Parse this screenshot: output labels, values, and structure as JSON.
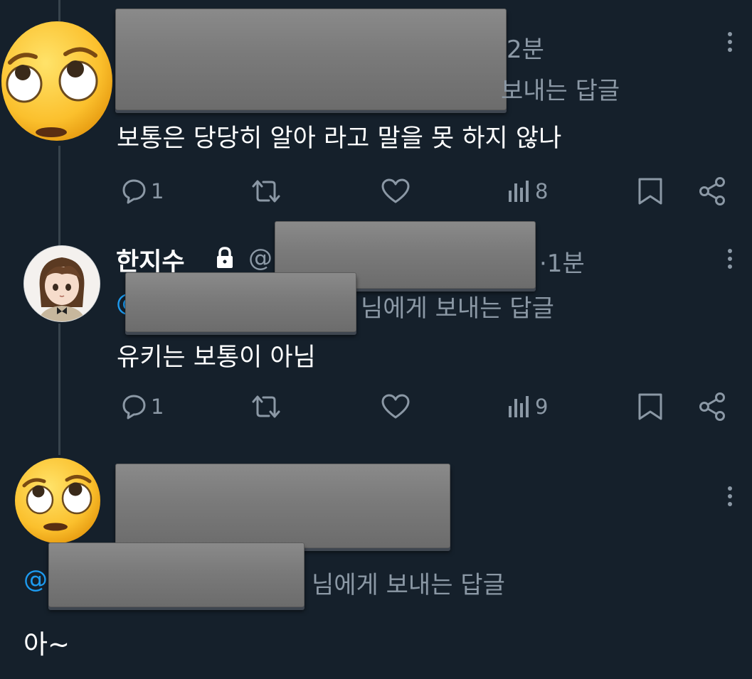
{
  "reply1": {
    "time": "2분",
    "replying_label": "보내는 답글",
    "text": "보통은 당당히 알아 라고 말을 못 하지 않나",
    "stats": {
      "replies": "1",
      "views": "8"
    },
    "icons": {
      "reply": "reply-icon",
      "retweet": "retweet-icon",
      "like": "heart-icon",
      "views": "views-icon",
      "bookmark": "bookmark-icon",
      "share": "share-icon",
      "more": "more-icon"
    }
  },
  "reply2": {
    "name": "한지수",
    "handle_at": "@",
    "time": "·1분",
    "mention_at": "@",
    "replying_label": "님에게 보내는 답글",
    "text": "유키는 보통이 아님",
    "stats": {
      "replies": "1",
      "views": "9"
    },
    "icons": {
      "lock": "lock-icon",
      "reply": "reply-icon",
      "retweet": "retweet-icon",
      "like": "heart-icon",
      "views": "views-icon",
      "bookmark": "bookmark-icon",
      "share": "share-icon",
      "more": "more-icon"
    }
  },
  "reply3": {
    "mention_at": "@",
    "replying_label": "님에게 보내는 답글",
    "text": "아~",
    "icons": {
      "more": "more-icon"
    }
  },
  "colors": {
    "background": "#15202b",
    "muted": "#8b98a5",
    "link": "#1d9bf0",
    "thread_line": "#38444d"
  }
}
